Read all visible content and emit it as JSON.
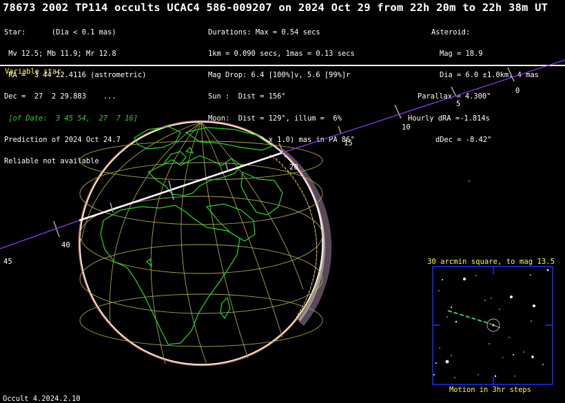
{
  "title": "78673 2002 TP114 occults UCAC4 586-009207 on 2024 Oct 29 from 22h 20m to 22h 38m UT",
  "star_info": {
    "line1": "Star:      (Dia < 0.1 mas)",
    "line2": " Mv 12.5; Mb 11.9; Mr 12.8",
    "line3": " RA =  3 44 22.4116 (astrometric)",
    "line4": "Dec =  27  2 29.883    ...",
    "line5_date": " [of Date:  3 45 54,  27  7 16]",
    "line6": "Prediction of 2024 Oct 24.7",
    "line7": "Reliable not available"
  },
  "event_info": {
    "line1": "Durations: Max = 0.54 secs",
    "line2": "1km = 0.090 secs, 1mas = 0.13 secs",
    "line3": "Mag Drop: 6.4 [100%]v, 5.6 [99%]r",
    "line4": "Sun :  Dist = 156°",
    "line5": "Moon:  Dist = 129°, illum =  6%",
    "line6": "1σ Err: ±(9.0 x 1.0) mas in PA 86°"
  },
  "asteroid_info": {
    "line1": "Asteroid:",
    "line2": "Mag = 18.9",
    "line3": "Dia = 6.0 ±1.0km, 4 mas",
    "line4": "Parallax = 4.300\"",
    "line5": "Hourly dRA =-1.814s",
    "line6": "dDec = -8.42\""
  },
  "variable_star_label": "Variable star",
  "track_labels": [
    "0",
    "5",
    "10",
    "15",
    "20",
    "40",
    "45"
  ],
  "finder": {
    "title": "30 arcmin square, to mag 13.5",
    "caption": "Motion in 3hr steps"
  },
  "footer": "Occult 4.2024.2.10",
  "colors": {
    "background": "#000000",
    "coast": "#22dd22",
    "grid": "#a8a84a",
    "track": "#a040ff",
    "shadow_path": "#ffffff",
    "label_yellow": "#ffff33",
    "finder_frame": "#1a2cff"
  }
}
